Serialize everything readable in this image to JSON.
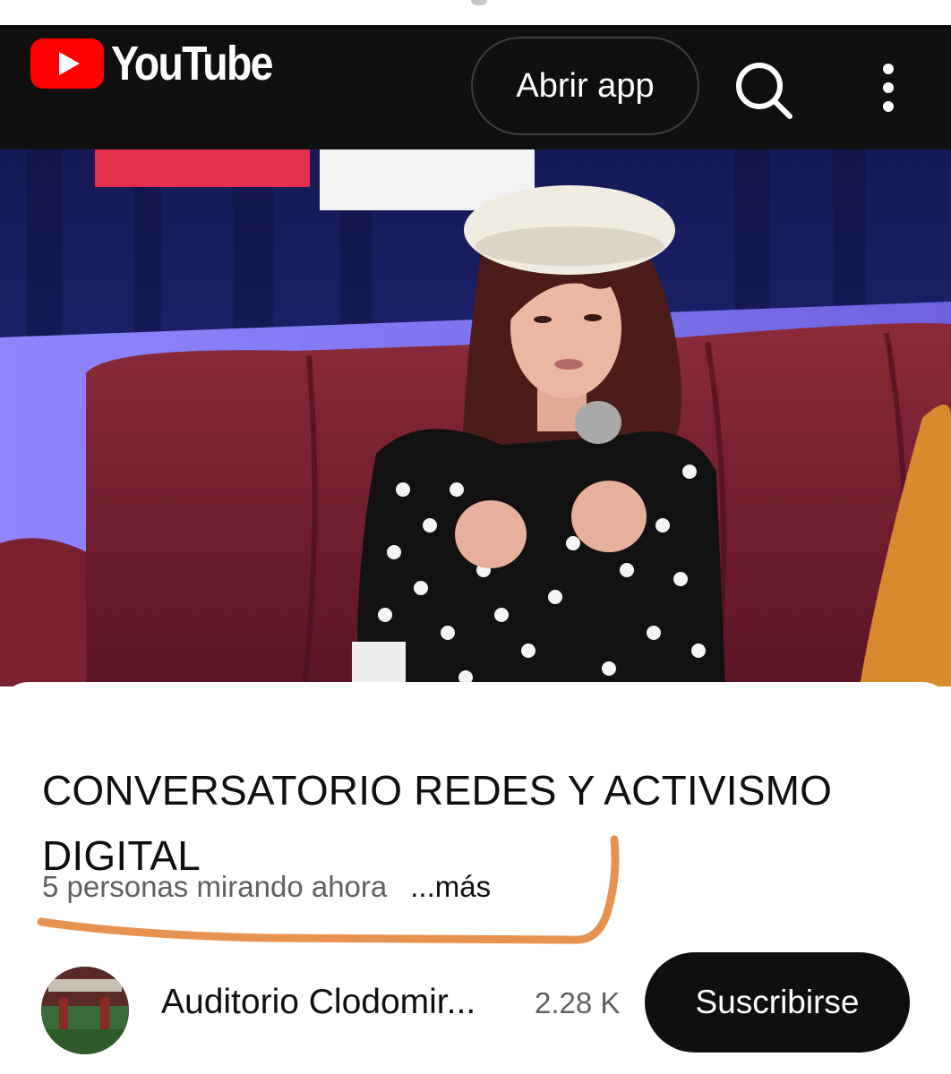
{
  "header": {
    "logo_text": "YouTube",
    "open_app_label": "Abrir app",
    "search_icon": "search-icon",
    "menu_icon": "more-vert-icon"
  },
  "video": {
    "thumbnail": "video-frame-speaker-with-microphone"
  },
  "details": {
    "title": "CONVERSATORIO REDES Y ACTIVISMO DIGITAL",
    "viewers": "5 personas mirando ahora",
    "more_label": "...más"
  },
  "channel": {
    "name": "Auditorio Clodomir...",
    "subscribers": "2.28 K",
    "subscribe_label": "Suscribirse",
    "avatar_icon": "channel-avatar"
  },
  "colors": {
    "header_bg": "#0f0f0f",
    "brand_red": "#ff0000",
    "highlight_stroke": "#e8924f",
    "secondary_text": "#606060"
  }
}
